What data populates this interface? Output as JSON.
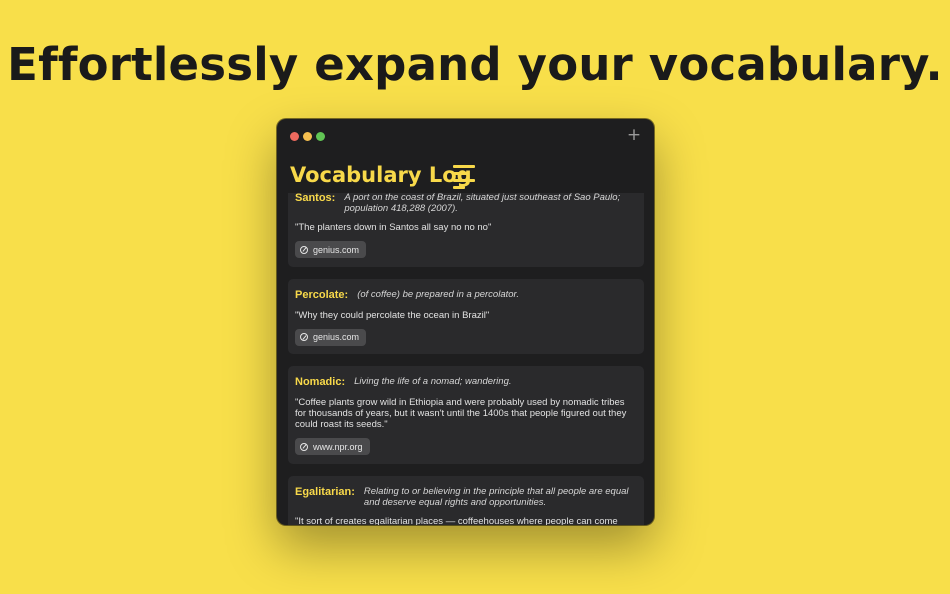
{
  "headline": "Effortlessly expand your vocabulary.",
  "window": {
    "title": "Vocabulary Log",
    "add_label": "+"
  },
  "entries": [
    {
      "word": "Santos:",
      "definition": "A port on the coast of Brazil, situated just southeast of Sao Paulo; population 418,288 (2007).",
      "quote": "\"The planters down in Santos all say no no no\"",
      "source": "genius.com"
    },
    {
      "word": "Percolate:",
      "definition": "(of coffee) be prepared in a percolator.",
      "quote": "\"Why they could percolate the ocean in Brazil\"",
      "source": "genius.com"
    },
    {
      "word": "Nomadic:",
      "definition": "Living the life of a nomad; wandering.",
      "quote": "\"Coffee plants grow wild in Ethiopia and were probably used by nomadic tribes for thousands of years, but it wasn't until the 1400s that people figured out they could roast its seeds.\"",
      "source": "www.npr.org"
    },
    {
      "word": "Egalitarian:",
      "definition": "Relating to or believing in the principle that all people are equal and deserve equal rights and opportunities.",
      "quote": "\"It sort of creates egalitarian places — coffeehouses where people can come together — and so the French Revolution and the American Revolution were planned in coffeehouses,\" Pendergrast says.\"",
      "source": ""
    }
  ],
  "colors": {
    "background": "#f8df4a",
    "accent": "#f8d94a",
    "window": "#1e1e1f",
    "card": "#2a2a2c"
  }
}
